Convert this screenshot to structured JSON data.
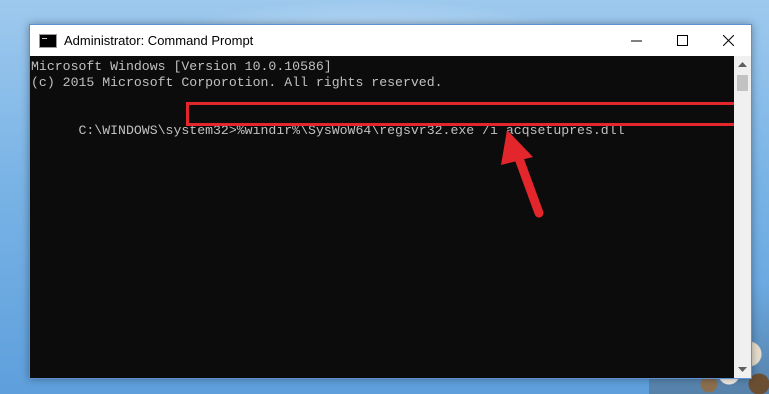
{
  "window": {
    "title": "Administrator: Command Prompt",
    "controls": {
      "minimize": "minimize",
      "maximize": "maximize",
      "close": "close"
    }
  },
  "console": {
    "lines": [
      "Microsoft Windows [Version 10.0.10586]",
      "(c) 2015 Microsoft Corporotion. All rights reserved."
    ],
    "prompt": "C:\\WINDOWS\\system32>",
    "command": "%windir%\\SysWoW64\\regsvr32.exe /i acqsetupres.dll"
  },
  "annotation": {
    "highlight_color": "#e3262b",
    "arrow_color": "#e3262b"
  },
  "icons": [
    "cmd-app-icon",
    "minimize-icon",
    "maximize-icon",
    "close-icon",
    "scroll-up-icon",
    "scroll-down-icon",
    "red-arrow-icon"
  ]
}
